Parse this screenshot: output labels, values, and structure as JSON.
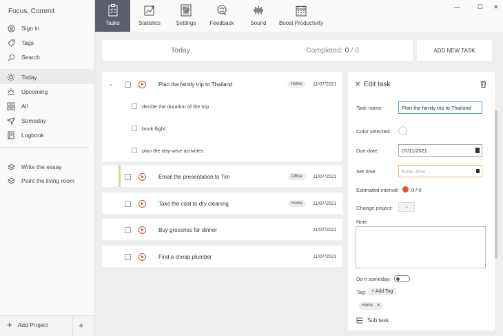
{
  "app": {
    "title": "Focus, Commit"
  },
  "sidebar": {
    "account": [
      {
        "label": "Sign in",
        "icon": "user-icon"
      },
      {
        "label": "Tags",
        "icon": "tag-icon"
      },
      {
        "label": "Search",
        "icon": "search-icon"
      }
    ],
    "views": [
      {
        "label": "Today",
        "icon": "sun-icon",
        "active": true
      },
      {
        "label": "Upcoming",
        "icon": "sunrise-icon"
      },
      {
        "label": "All",
        "icon": "grid-icon"
      },
      {
        "label": "Someday",
        "icon": "send-icon"
      },
      {
        "label": "Logbook",
        "icon": "logbook-icon"
      }
    ],
    "projects": [
      {
        "label": "Write the essay",
        "icon": "layers-icon"
      },
      {
        "label": "Paint the living room",
        "icon": "layers-icon"
      }
    ],
    "add_project": "Add Project"
  },
  "topnav": {
    "tabs": [
      {
        "label": "Tasks",
        "icon": "tasks-icon",
        "active": true
      },
      {
        "label": "Statistics",
        "icon": "statistics-icon"
      },
      {
        "label": "Settings",
        "icon": "settings-icon"
      },
      {
        "label": "Feedback",
        "icon": "feedback-icon"
      },
      {
        "label": "Sound",
        "icon": "sound-icon"
      },
      {
        "label": "Boost Productivity",
        "icon": "calendar-icon"
      }
    ]
  },
  "summary": {
    "today": "Today",
    "completed_label": "Completed:",
    "completed_done": "0",
    "completed_sep": "/",
    "completed_total": "0",
    "add_new_task": "ADD NEW TASK"
  },
  "tasks": [
    {
      "title": "Plan the family trip to Thailand",
      "tag": "Home",
      "due": "11/07/2021",
      "subtasks": [
        "decide the duration of the trip",
        "book flight",
        "plan the day-wise activities"
      ]
    },
    {
      "title": "Email the presentation to Tim",
      "tag": "Office",
      "due": "11/07/2021"
    },
    {
      "title": "Take the coat to dry cleaning",
      "tag": "Home",
      "due": "11/07/2021"
    },
    {
      "title": "Buy groceries for dinner",
      "tag": "",
      "due": "11/07/2021"
    },
    {
      "title": "Find a cheap plumber",
      "tag": "",
      "due": "11/07/2021"
    }
  ],
  "edit_panel": {
    "title": "Edit task",
    "task_name_label": "Task name:",
    "task_name_value": "Plan the family trip to Thailand",
    "color_label": "Color selected:",
    "due_label": "Due date:",
    "due_value": "07/11/2021",
    "set_time_label": "Set time:",
    "set_time_placeholder": "Enter time",
    "estimated_label": "Estimated interval:",
    "estimated_value": "0 / 0",
    "project_label": "Change project:",
    "note_label": "Note",
    "someday_label": "Do it someday:",
    "tag_label": "Tag:",
    "add_tag": "+ Add Tag",
    "tag_chip": "Home",
    "subtask_label": "Sub task"
  },
  "colors": {
    "accent": "#c1533d",
    "active_tab": "#5a5f6b",
    "focus": "#5b9bd5",
    "time_border": "#e6c46b",
    "office_bar": "#c6e08d"
  }
}
